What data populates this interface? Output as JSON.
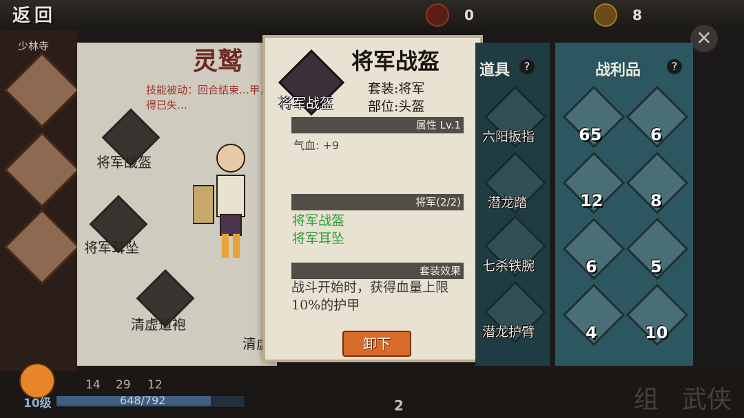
{
  "topbar": {
    "back_label": "返回",
    "location": "少林寺",
    "resources": [
      {
        "icon": "red-gem-icon",
        "value": "0"
      },
      {
        "icon": "coin-icon",
        "value": "8"
      }
    ]
  },
  "character": {
    "name": "灵鹫",
    "skill_text": "技能被动：回合结束…甲，获得已失…",
    "equipment": [
      {
        "label": "将军战盔"
      },
      {
        "label": "将军耳坠"
      },
      {
        "label": "清虚道袍"
      },
      {
        "label": "清虚"
      }
    ]
  },
  "popup": {
    "title": "将军战盔",
    "icon_label": "将军战盔",
    "set_line": "套装:将军",
    "part_line": "部位:头盔",
    "attr_header": "属性 Lv.1",
    "stat": "气血: +9",
    "set_header": "将军(2/2)",
    "set_items": [
      "将军战盔",
      "将军耳坠"
    ],
    "effect_header": "套装效果",
    "effect_text": "战斗开始时，获得血量上限10%的护甲",
    "unequip_label": "卸下"
  },
  "tools": {
    "header": "道具",
    "items": [
      {
        "label": "六阳扳指"
      },
      {
        "label": "潜龙踏"
      },
      {
        "label": "七杀铁腕"
      },
      {
        "label": "潜龙护臂"
      }
    ]
  },
  "loot": {
    "header": "战利品",
    "items": [
      {
        "count": "65"
      },
      {
        "count": "6"
      },
      {
        "count": "12"
      },
      {
        "count": "8"
      },
      {
        "count": "6"
      },
      {
        "count": "5"
      },
      {
        "count": "4"
      },
      {
        "count": "10"
      }
    ]
  },
  "player": {
    "level": "10级",
    "xp": "648/792",
    "xp_fraction": 0.818,
    "stats": [
      "14",
      "29",
      "12"
    ],
    "bottom_count": "2"
  },
  "bottom_labels": [
    "组",
    "武侠"
  ],
  "help_icon": "?"
}
